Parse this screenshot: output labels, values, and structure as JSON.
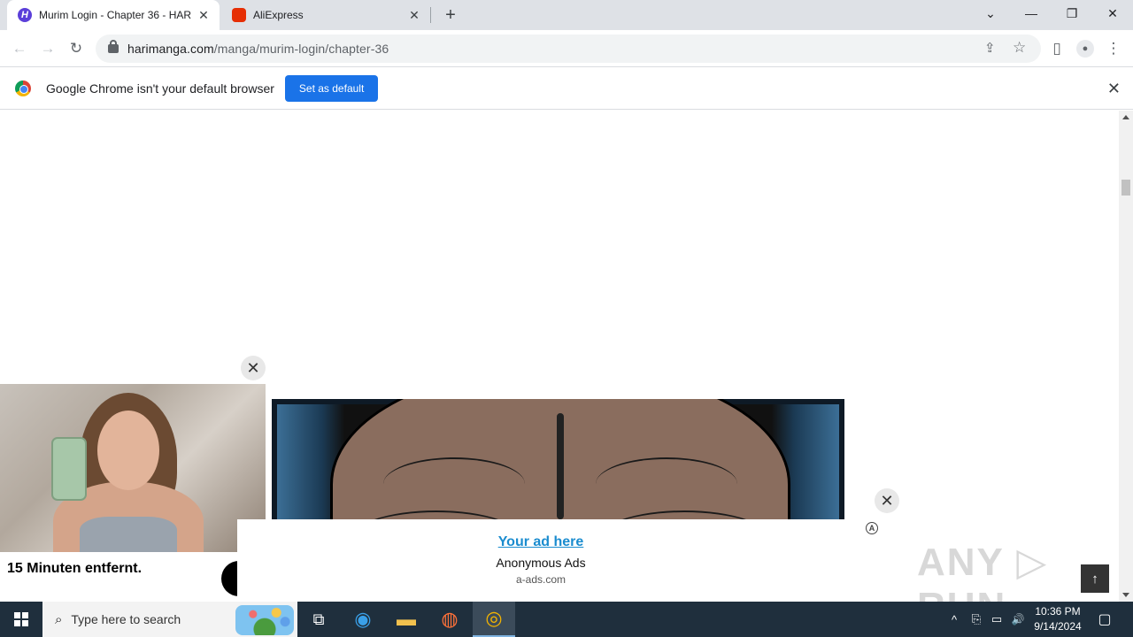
{
  "browser": {
    "tabs": [
      {
        "label": "Murim Login - Chapter 36 - HAR",
        "favicon": "H",
        "favicon_color": "#5b3fd9",
        "active": true
      },
      {
        "label": "AliExpress",
        "favicon": "",
        "favicon_color": "#e62e04",
        "active": false
      }
    ],
    "new_tab": "+",
    "window_controls": {
      "dropdown": "⌄",
      "minimize": "—",
      "restore": "❐",
      "close": "✕"
    },
    "toolbar": {
      "back": "←",
      "forward": "→",
      "reload": "↻",
      "url_host": "harimanga.com",
      "url_path": "/manga/murim-login/chapter-36",
      "share": "⇪",
      "bookmark": "☆",
      "sidepanel": "▯",
      "profile": "●",
      "menu": "⋮"
    },
    "infobar": {
      "message": "Google Chrome isn't your default browser",
      "button": "Set as default",
      "close": "✕"
    }
  },
  "page": {
    "photo_ad": {
      "close": "✕",
      "caption": "15 Minuten entfernt."
    },
    "bottom_ad": {
      "close": "✕",
      "headline": "Your ad here",
      "brand": "Anonymous Ads",
      "domain": "a-ads.com",
      "adchoice": "A"
    },
    "watermark": "ANY ▷ RUN",
    "to_top": "↑"
  },
  "taskbar": {
    "search_placeholder": "Type here to search",
    "search_icon": "⌕",
    "apps": [
      {
        "name": "task-view",
        "glyph": "⧉"
      },
      {
        "name": "edge",
        "glyph": "◉"
      },
      {
        "name": "file-explorer",
        "glyph": "▬"
      },
      {
        "name": "firefox",
        "glyph": "◍"
      },
      {
        "name": "chrome",
        "glyph": "◎"
      }
    ],
    "tray": {
      "chevron": "^",
      "network": "▭",
      "volume": "🔊"
    },
    "time": "10:36 PM",
    "date": "9/14/2024",
    "notification": "▢"
  }
}
